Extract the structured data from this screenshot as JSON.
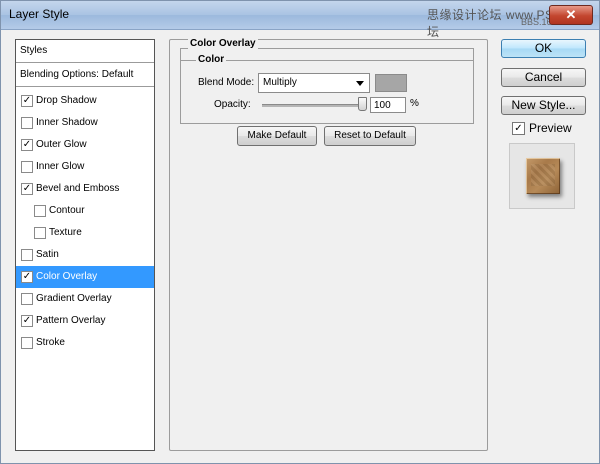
{
  "window": {
    "title": "Layer Style",
    "watermark": "思缘设计论坛 www.PS教程论坛",
    "watermark2": "BBS.16XX8.COM",
    "close_glyph": "✕"
  },
  "styles_panel": {
    "header": "Styles",
    "blending_options": "Blending Options: Default",
    "items": [
      {
        "label": "Drop Shadow",
        "checked": true,
        "indent": false,
        "selected": false
      },
      {
        "label": "Inner Shadow",
        "checked": false,
        "indent": false,
        "selected": false
      },
      {
        "label": "Outer Glow",
        "checked": true,
        "indent": false,
        "selected": false
      },
      {
        "label": "Inner Glow",
        "checked": false,
        "indent": false,
        "selected": false
      },
      {
        "label": "Bevel and Emboss",
        "checked": true,
        "indent": false,
        "selected": false
      },
      {
        "label": "Contour",
        "checked": false,
        "indent": true,
        "selected": false
      },
      {
        "label": "Texture",
        "checked": false,
        "indent": true,
        "selected": false
      },
      {
        "label": "Satin",
        "checked": false,
        "indent": false,
        "selected": false
      },
      {
        "label": "Color Overlay",
        "checked": true,
        "indent": false,
        "selected": true
      },
      {
        "label": "Gradient Overlay",
        "checked": false,
        "indent": false,
        "selected": false
      },
      {
        "label": "Pattern Overlay",
        "checked": true,
        "indent": false,
        "selected": false
      },
      {
        "label": "Stroke",
        "checked": false,
        "indent": false,
        "selected": false
      }
    ]
  },
  "color_overlay": {
    "section_title": "Color Overlay",
    "group_title": "Color",
    "blend_mode_label": "Blend Mode:",
    "blend_mode_value": "Multiply",
    "swatch_color": "#a6a6a6",
    "opacity_label": "Opacity:",
    "opacity_value": "100",
    "opacity_unit": "%",
    "opacity_fraction": 1.0,
    "make_default": "Make Default",
    "reset_default": "Reset to Default"
  },
  "actions": {
    "ok": "OK",
    "cancel": "Cancel",
    "new_style": "New Style...",
    "preview_label": "Preview",
    "preview_checked": true
  },
  "checkmark": "✓"
}
